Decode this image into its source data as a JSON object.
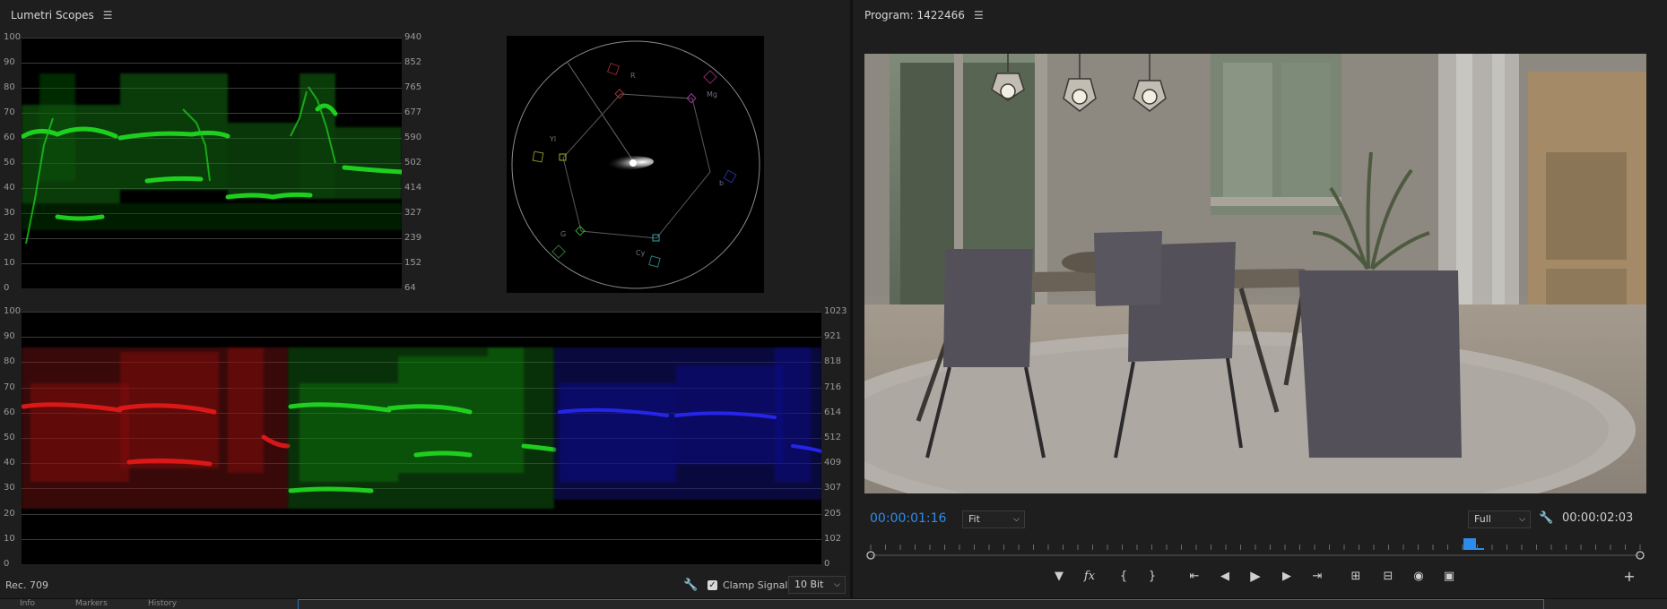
{
  "scopes": {
    "title": "Lumetri Scopes",
    "menu_icon": "hamburger-menu-icon",
    "waveform_left_ticks": [
      "100",
      "90",
      "80",
      "70",
      "60",
      "50",
      "40",
      "30",
      "20",
      "10",
      "0"
    ],
    "waveform_right_ticks": [
      "940",
      "852",
      "765",
      "677",
      "590",
      "502",
      "414",
      "327",
      "239",
      "152",
      "64"
    ],
    "parade_left_ticks": [
      "100",
      "90",
      "80",
      "70",
      "60",
      "50",
      "40",
      "30",
      "20",
      "10",
      "0"
    ],
    "parade_right_ticks": [
      "1023",
      "921",
      "818",
      "716",
      "614",
      "512",
      "409",
      "307",
      "205",
      "102",
      "0"
    ],
    "vectorscope_labels": {
      "r": "R",
      "mg": "Mg",
      "b": "b",
      "cy": "Cy",
      "g": "G",
      "yl": "Yl"
    },
    "footer": {
      "color_space": "Rec. 709",
      "clamp_signal_label": "Clamp Signal",
      "clamp_signal_checked": true,
      "bit_depth": "10 Bit"
    },
    "colors": {
      "waveform_green": "#1fd11f",
      "parade_red": "#e01414",
      "parade_blue": "#1c1cf0"
    }
  },
  "program": {
    "title": "Program: 1422466",
    "menu_icon": "hamburger-menu-icon",
    "current_timecode": "00:00:01:16",
    "zoom_value": "Fit",
    "resolution_value": "Full",
    "duration_timecode": "00:00:02:03",
    "colors": {
      "timecode_blue": "#2d8ceb"
    }
  },
  "bottom_strip": {
    "tabs": [
      "Info",
      "Markers",
      "History"
    ]
  }
}
